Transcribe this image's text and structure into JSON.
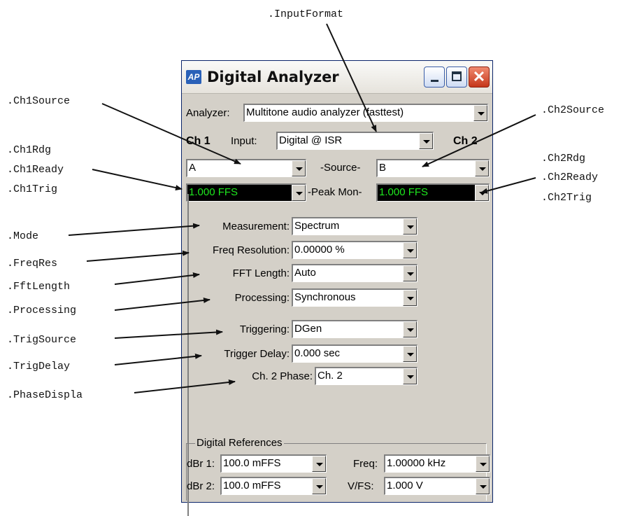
{
  "annotations": {
    "input_format": ".InputFormat",
    "ch1_source": ".Ch1Source",
    "ch1_rdg": ".Ch1Rdg",
    "ch1_ready": ".Ch1Ready",
    "ch1_trig": ".Ch1Trig",
    "mode": ".Mode",
    "freq_res": ".FreqRes",
    "fft_length": ".FftLength",
    "processing": ".Processing",
    "trig_source": ".TrigSource",
    "trig_delay": ".TrigDelay",
    "phase_display": ".PhaseDispla",
    "ch2_source": ".Ch2Source",
    "ch2_rdg": ".Ch2Rdg",
    "ch2_ready": ".Ch2Ready",
    "ch2_trig": ".Ch2Trig"
  },
  "window": {
    "logo": "AP",
    "title": "Digital Analyzer",
    "close_glyph": "✕"
  },
  "analyzer": {
    "label": "Analyzer:",
    "value": "Multitone audio analyzer (fasttest)"
  },
  "channels": {
    "ch1_label": "Ch 1",
    "ch2_label": "Ch 2",
    "input_label": "Input:",
    "input_value": "Digital @ ISR",
    "source_label": "-Source-",
    "ch1_source": "A",
    "ch2_source": "B",
    "peak_label": "-Peak Mon-",
    "ch1_peak": "1.000   FFS",
    "ch2_peak": "1.000   FFS"
  },
  "settings": {
    "measurement_label": "Measurement:",
    "measurement_value": "Spectrum",
    "freqres_label": "Freq Resolution:",
    "freqres_value": "0.00000  %",
    "fft_label": "FFT Length:",
    "fft_value": "Auto",
    "processing_label": "Processing:",
    "processing_value": "Synchronous",
    "triggering_label": "Triggering:",
    "triggering_value": "DGen",
    "trigdelay_label": "Trigger Delay:",
    "trigdelay_value": "0.000    sec",
    "phase_label": "Ch. 2 Phase:",
    "phase_value": "Ch. 2"
  },
  "digital_references": {
    "title": "Digital References",
    "dbr1_label": "dBr 1:",
    "dbr1_value": "100.0   mFFS",
    "dbr2_label": "dBr 2:",
    "dbr2_value": "100.0   mFFS",
    "freq_label": "Freq:",
    "freq_value": "1.00000 kHz",
    "vfs_label": "V/FS:",
    "vfs_value": "1.000    V"
  }
}
